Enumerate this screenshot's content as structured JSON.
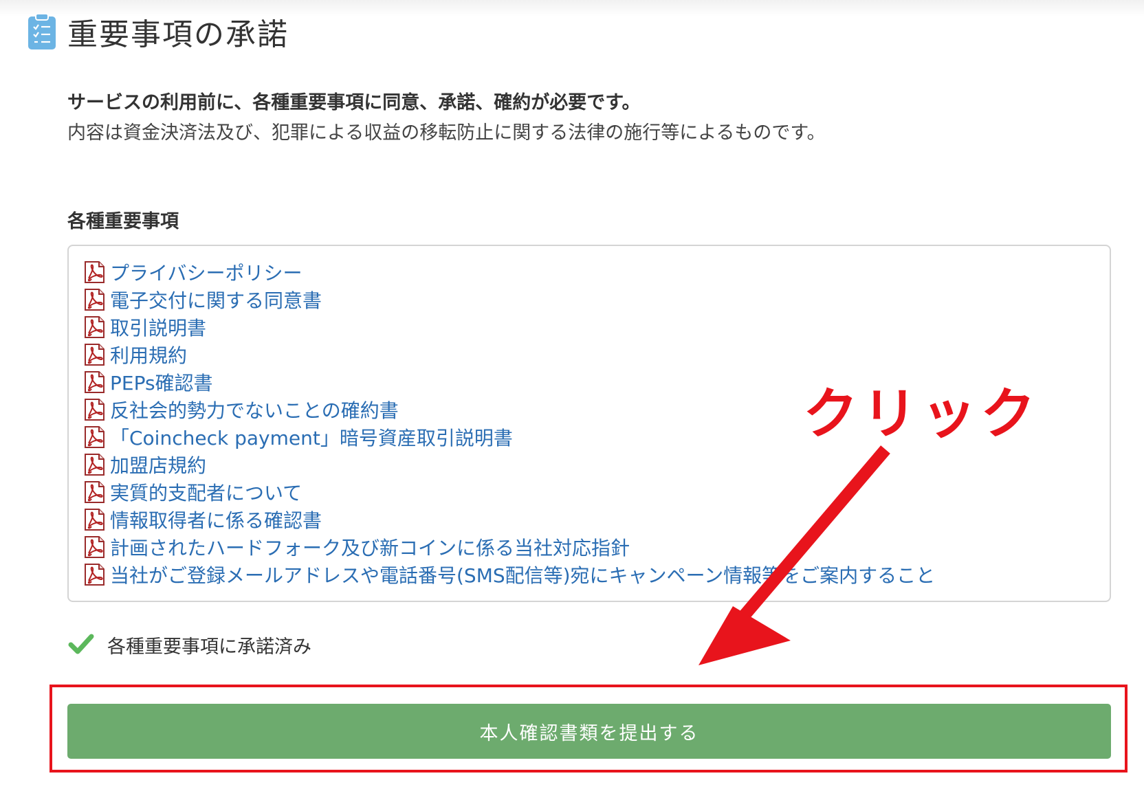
{
  "header": {
    "title": "重要事項の承諾",
    "icon": "clipboard-checklist-icon",
    "icon_color": "#6cb4e4"
  },
  "intro": {
    "bold_line": "サービスの利用前に、各種重要事項に同意、承諾、確約が必要です。",
    "text_line": "内容は資金決済法及び、犯罪による収益の移転防止に関する法律の施行等によるものです。"
  },
  "documents": {
    "title": "各種重要事項",
    "icon": "pdf-icon",
    "link_color": "#2a6db3",
    "items": [
      {
        "label": "プライバシーポリシー"
      },
      {
        "label": "電子交付に関する同意書"
      },
      {
        "label": "取引説明書"
      },
      {
        "label": "利用規約"
      },
      {
        "label": "PEPs確認書"
      },
      {
        "label": "反社会的勢力でないことの確約書"
      },
      {
        "label": "「Coincheck payment」暗号資産取引説明書"
      },
      {
        "label": "加盟店規約"
      },
      {
        "label": "実質的支配者について"
      },
      {
        "label": "情報取得者に係る確認書"
      },
      {
        "label": "計画されたハードフォーク及び新コインに係る当社対応指針"
      },
      {
        "label": "当社がご登録メールアドレスや電話番号(SMS配信等)宛にキャンペーン情報等をご案内すること"
      }
    ]
  },
  "status": {
    "icon": "check-icon",
    "text": "各種重要事項に承諾済み",
    "color": "#5cb85c"
  },
  "submit": {
    "label": "本人確認書類を提出する",
    "color": "#6dab6e"
  },
  "annotation": {
    "label": "クリック",
    "color": "#e8141c"
  }
}
